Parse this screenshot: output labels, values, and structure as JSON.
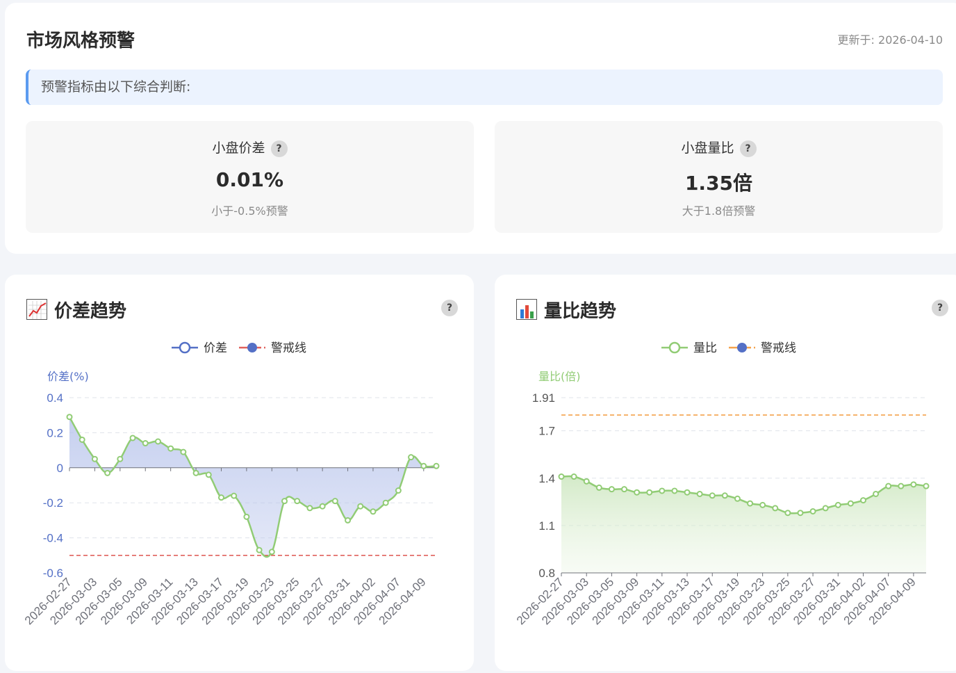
{
  "header": {
    "title": "市场风格预警",
    "updated": "更新于: 2026-04-10",
    "banner": "预警指标由以下综合判断:"
  },
  "metrics": [
    {
      "label": "小盘价差",
      "help": "?",
      "value": "0.01%",
      "sub": "小于-0.5%预警"
    },
    {
      "label": "小盘量比",
      "help": "?",
      "value": "1.35倍",
      "sub": "大于1.8倍预警"
    }
  ],
  "icons": {
    "spread_chart_icon": "chart-increasing-icon",
    "volume_chart_icon": "bar-chart-icon",
    "help_icon": "question-mark-icon"
  },
  "colors": {
    "spread_series": "#91cc75",
    "spread_area": "#b3c0ea",
    "spread_legend": "#5470c6",
    "spread_alert": "#e0605c",
    "volume_series": "#91cc75",
    "volume_alert": "#f4a24c",
    "legend_alert_dot": "#5470c6"
  },
  "chart_data": [
    {
      "type": "area",
      "title": "价差趋势",
      "help": "?",
      "ylabel": "价差(%)",
      "legend": [
        "价差",
        "警戒线"
      ],
      "legend_position": "top-center",
      "grid": true,
      "ylim": [
        -0.6,
        0.4
      ],
      "yticks": [
        "0.4",
        "0.2",
        "0",
        "-0.2",
        "-0.4",
        "-0.6"
      ],
      "xtick_labels": [
        "2026-02-27",
        "2026-03-03",
        "2026-03-05",
        "2026-03-09",
        "2026-03-11",
        "2026-03-13",
        "2026-03-17",
        "2026-03-19",
        "2026-03-23",
        "2026-03-25",
        "2026-03-27",
        "2026-03-31",
        "2026-04-02",
        "2026-04-07",
        "2026-04-09"
      ],
      "alert_line": -0.5,
      "series": [
        {
          "name": "价差",
          "values": [
            0.29,
            0.16,
            0.05,
            -0.03,
            0.05,
            0.17,
            0.14,
            0.15,
            0.11,
            0.09,
            -0.03,
            -0.04,
            -0.17,
            -0.16,
            -0.28,
            -0.47,
            -0.48,
            -0.19,
            -0.19,
            -0.23,
            -0.22,
            -0.19,
            -0.3,
            -0.22,
            -0.25,
            -0.2,
            -0.13,
            0.06,
            0.01,
            0.01
          ]
        }
      ]
    },
    {
      "type": "area",
      "title": "量比趋势",
      "help": "?",
      "ylabel": "量比(倍)",
      "legend": [
        "量比",
        "警戒线"
      ],
      "legend_position": "top-center",
      "grid": true,
      "ylim": [
        0.8,
        1.91
      ],
      "yticks": [
        "1.91",
        "1.7",
        "1.4",
        "1.1",
        "0.8"
      ],
      "xtick_labels": [
        "2026-02-27",
        "2026-03-03",
        "2026-03-05",
        "2026-03-09",
        "2026-03-11",
        "2026-03-13",
        "2026-03-17",
        "2026-03-19",
        "2026-03-23",
        "2026-03-25",
        "2026-03-27",
        "2026-03-31",
        "2026-04-02",
        "2026-04-07",
        "2026-04-09"
      ],
      "alert_line": 1.8,
      "series": [
        {
          "name": "量比",
          "values": [
            1.41,
            1.41,
            1.38,
            1.34,
            1.33,
            1.33,
            1.31,
            1.31,
            1.32,
            1.32,
            1.31,
            1.3,
            1.29,
            1.29,
            1.27,
            1.24,
            1.23,
            1.21,
            1.18,
            1.18,
            1.19,
            1.21,
            1.23,
            1.24,
            1.26,
            1.3,
            1.35,
            1.35,
            1.36,
            1.35
          ]
        }
      ]
    }
  ]
}
